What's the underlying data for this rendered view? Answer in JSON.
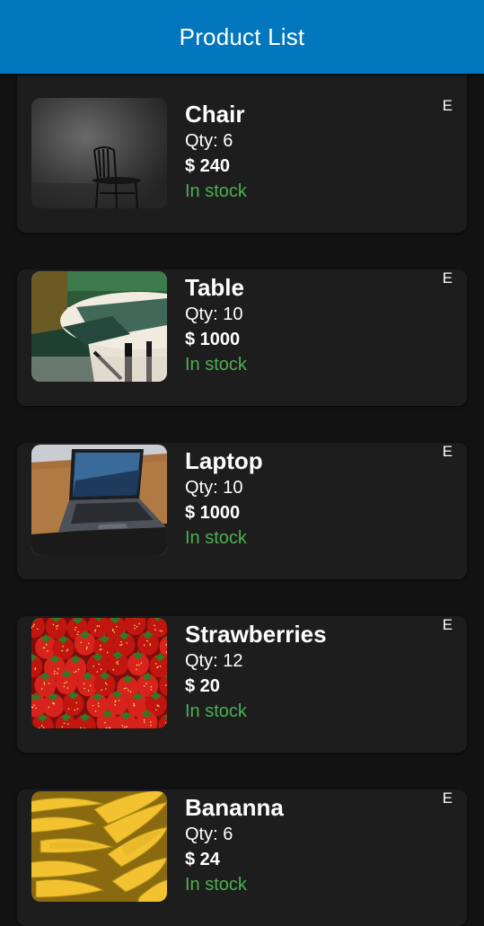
{
  "appbar": {
    "title": "Product List",
    "color": "#0277bd"
  },
  "products": [
    {
      "name": "Chair",
      "qty": "Qty: 6",
      "price": "$ 240",
      "status": "In stock",
      "edit_label": "E",
      "image": "chair-photo"
    },
    {
      "name": "Table",
      "qty": "Qty: 10",
      "price": "$ 1000",
      "status": "In stock",
      "edit_label": "E",
      "image": "table-photo"
    },
    {
      "name": "Laptop",
      "qty": "Qty: 10",
      "price": "$ 1000",
      "status": "In stock",
      "edit_label": "E",
      "image": "laptop-photo"
    },
    {
      "name": "Strawberries",
      "qty": "Qty: 12",
      "price": "$ 20",
      "status": "In stock",
      "edit_label": "E",
      "image": "strawberries-photo"
    },
    {
      "name": "Bananna",
      "qty": "Qty: 6",
      "price": "$ 24",
      "status": "In stock",
      "edit_label": "E",
      "image": "bananas-photo"
    }
  ],
  "colors": {
    "background": "#121212",
    "card": "#1d1d1d",
    "in_stock": "#4caf50"
  }
}
